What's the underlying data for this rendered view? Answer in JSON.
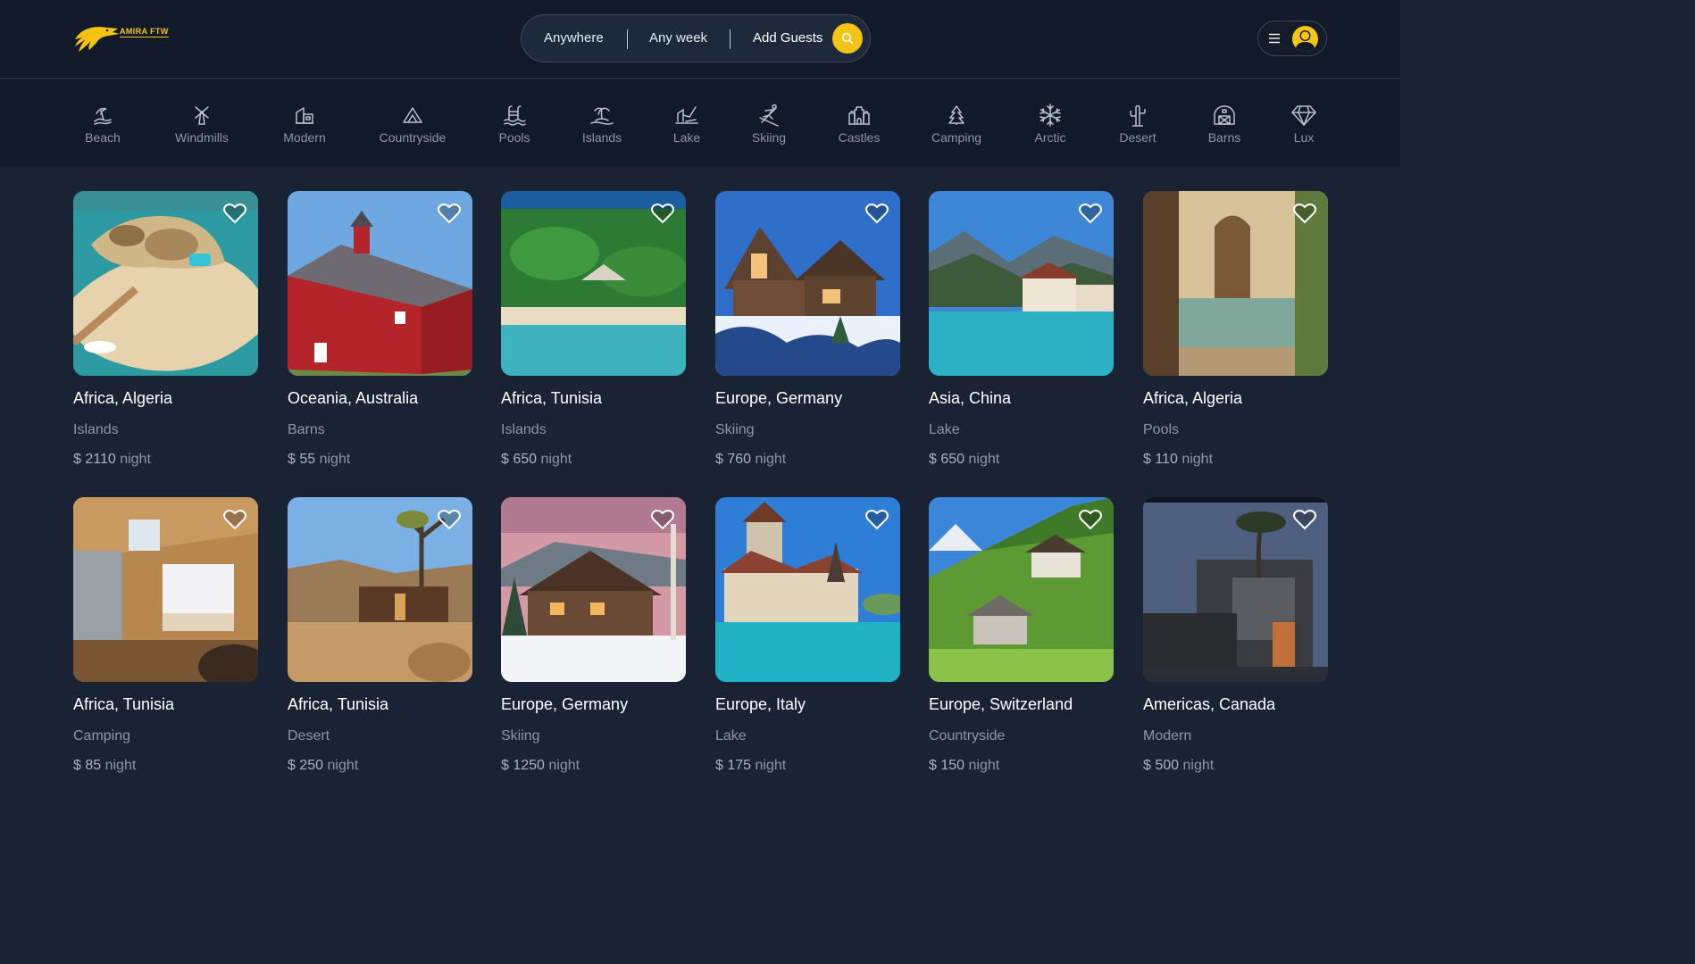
{
  "brand": {
    "name": "AMIRA FTW",
    "accent": "#f3c316"
  },
  "search": {
    "anywhere": "Anywhere",
    "week": "Any week",
    "guests": "Add Guests"
  },
  "categories": [
    {
      "label": "Beach",
      "icon": "beach-icon"
    },
    {
      "label": "Windmills",
      "icon": "windmill-icon"
    },
    {
      "label": "Modern",
      "icon": "modern-house-icon"
    },
    {
      "label": "Countryside",
      "icon": "mountain-icon"
    },
    {
      "label": "Pools",
      "icon": "pool-icon"
    },
    {
      "label": "Islands",
      "icon": "island-icon"
    },
    {
      "label": "Lake",
      "icon": "lake-icon"
    },
    {
      "label": "Skiing",
      "icon": "skiing-icon"
    },
    {
      "label": "Castles",
      "icon": "castle-icon"
    },
    {
      "label": "Camping",
      "icon": "camping-icon"
    },
    {
      "label": "Arctic",
      "icon": "snowflake-icon"
    },
    {
      "label": "Desert",
      "icon": "cactus-icon"
    },
    {
      "label": "Barns",
      "icon": "barn-icon"
    },
    {
      "label": "Lux",
      "icon": "diamond-icon"
    }
  ],
  "listings": [
    {
      "location": "Africa, Algeria",
      "category": "Islands",
      "price": "$ 2110",
      "unit": "night"
    },
    {
      "location": "Oceania, Australia",
      "category": "Barns",
      "price": "$ 55",
      "unit": "night"
    },
    {
      "location": "Africa, Tunisia",
      "category": "Islands",
      "price": "$ 650",
      "unit": "night"
    },
    {
      "location": "Europe, Germany",
      "category": "Skiing",
      "price": "$ 760",
      "unit": "night"
    },
    {
      "location": "Asia, China",
      "category": "Lake",
      "price": "$ 650",
      "unit": "night"
    },
    {
      "location": "Africa, Algeria",
      "category": "Pools",
      "price": "$ 110",
      "unit": "night"
    },
    {
      "location": "Africa, Tunisia",
      "category": "Camping",
      "price": "$ 85",
      "unit": "night"
    },
    {
      "location": "Africa, Tunisia",
      "category": "Desert",
      "price": "$ 250",
      "unit": "night"
    },
    {
      "location": "Europe, Germany",
      "category": "Skiing",
      "price": "$ 1250",
      "unit": "night"
    },
    {
      "location": "Europe, Italy",
      "category": "Lake",
      "price": "$ 175",
      "unit": "night"
    },
    {
      "location": "Europe, Switzerland",
      "category": "Countryside",
      "price": "$ 150",
      "unit": "night"
    },
    {
      "location": "Americas, Canada",
      "category": "Modern",
      "price": "$ 500",
      "unit": "night"
    }
  ]
}
